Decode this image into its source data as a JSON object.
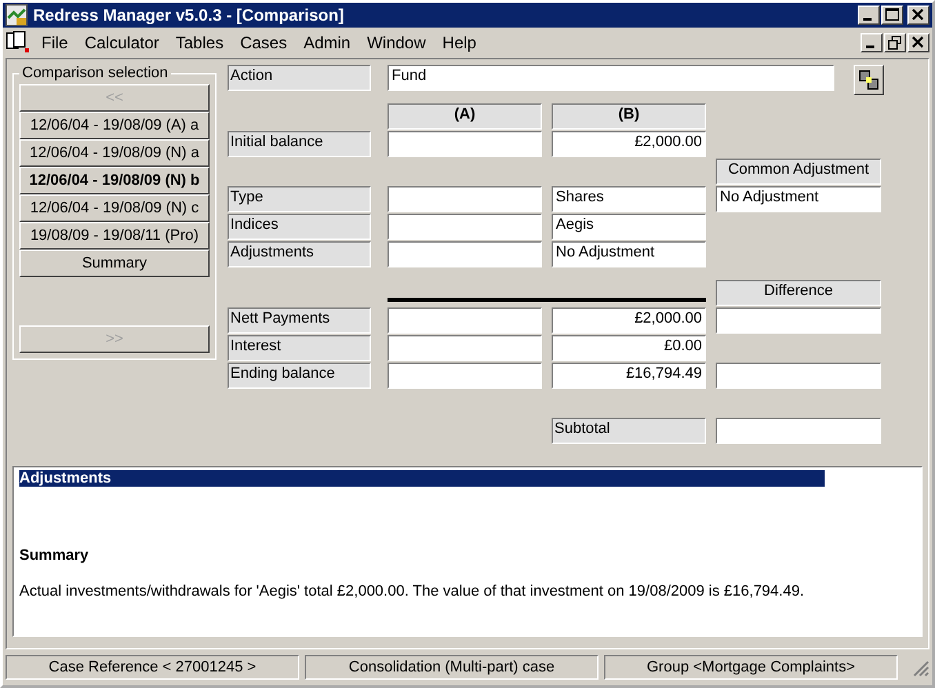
{
  "window": {
    "title": "Redress Manager v5.0.3 - [Comparison]"
  },
  "menu": [
    {
      "label": "File"
    },
    {
      "label": "Calculator"
    },
    {
      "label": "Tables"
    },
    {
      "label": "Cases"
    },
    {
      "label": "Admin"
    },
    {
      "label": "Window"
    },
    {
      "label": "Help"
    }
  ],
  "comparison_selection": {
    "title": "Comparison selection",
    "previous": {
      "label": "<<",
      "disabled": true
    },
    "items": [
      {
        "label": "12/06/04 - 19/08/09 (A) a",
        "selected": false
      },
      {
        "label": "12/06/04 - 19/08/09 (N) a",
        "selected": false
      },
      {
        "label": "12/06/04 - 19/08/09 (N) b",
        "selected": true
      },
      {
        "label": "12/06/04 - 19/08/09 (N) c",
        "selected": false
      },
      {
        "label": "19/08/09 - 19/08/11 (Pro)",
        "selected": false
      },
      {
        "label": "Summary",
        "selected": false
      }
    ],
    "next": {
      "label": ">>",
      "disabled": true
    }
  },
  "action": {
    "label": "Action",
    "value": "Fund"
  },
  "columns": [
    "(A)",
    "(B)"
  ],
  "initial_balance": {
    "label": "Initial balance",
    "b": "£2,000.00"
  },
  "common_adjustment": {
    "heading": "Common Adjustment",
    "value": "No Adjustment"
  },
  "details": [
    {
      "label": "Type",
      "b": "Shares"
    },
    {
      "label": "Indices",
      "b": "Aegis"
    },
    {
      "label": "Adjustments",
      "b": "No Adjustment"
    }
  ],
  "difference_heading": "Difference",
  "results": [
    {
      "label": "Nett Payments",
      "b": "£2,000.00",
      "kind": "with_difference"
    },
    {
      "label": "Interest",
      "b": "£0.00",
      "kind": "plain"
    },
    {
      "label": "Ending balance",
      "b": "£16,794.49",
      "kind": "with_difference"
    }
  ],
  "subtotal": {
    "label": "Subtotal"
  },
  "report": {
    "selected_heading": "Adjustments",
    "summary_heading": "Summary",
    "text": "Actual investments/withdrawals for 'Aegis' total £2,000.00. The value of that investment on 19/08/2009 is £16,794.49."
  },
  "status_bar": [
    "Case Reference < 27001245 >",
    "Consolidation (Multi-part) case",
    "Group <Mortgage Complaints>"
  ]
}
